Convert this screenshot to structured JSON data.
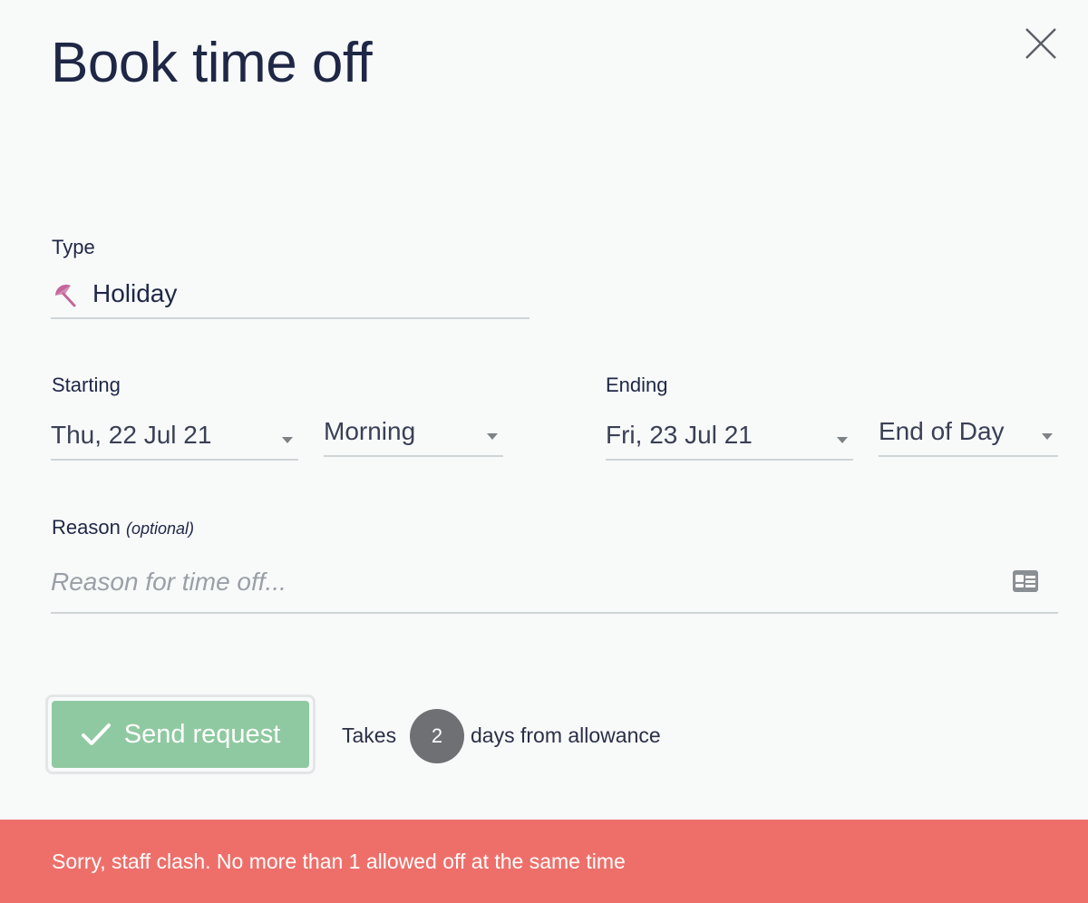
{
  "dialog": {
    "title": "Book time off",
    "close_icon": "close-icon"
  },
  "type": {
    "label": "Type",
    "value": "Holiday",
    "icon": "umbrella-icon",
    "icon_color": "#c4679a"
  },
  "starting": {
    "label": "Starting",
    "date": "Thu, 22 Jul 21",
    "part": "Morning"
  },
  "ending": {
    "label": "Ending",
    "date": "Fri, 23 Jul 21",
    "part": "End of Day"
  },
  "reason": {
    "label": "Reason",
    "optional_note": "(optional)",
    "placeholder": "Reason for time off...",
    "value": "",
    "icon": "contact-card-icon"
  },
  "actions": {
    "send_label": "Send request",
    "send_color": "#8fc9a1",
    "takes_prefix": "Takes",
    "days_count": "2",
    "takes_suffix": "days from allowance"
  },
  "error": {
    "message": "Sorry, staff clash. No more than 1 allowed off at the same time",
    "color": "#ee6f6a"
  }
}
